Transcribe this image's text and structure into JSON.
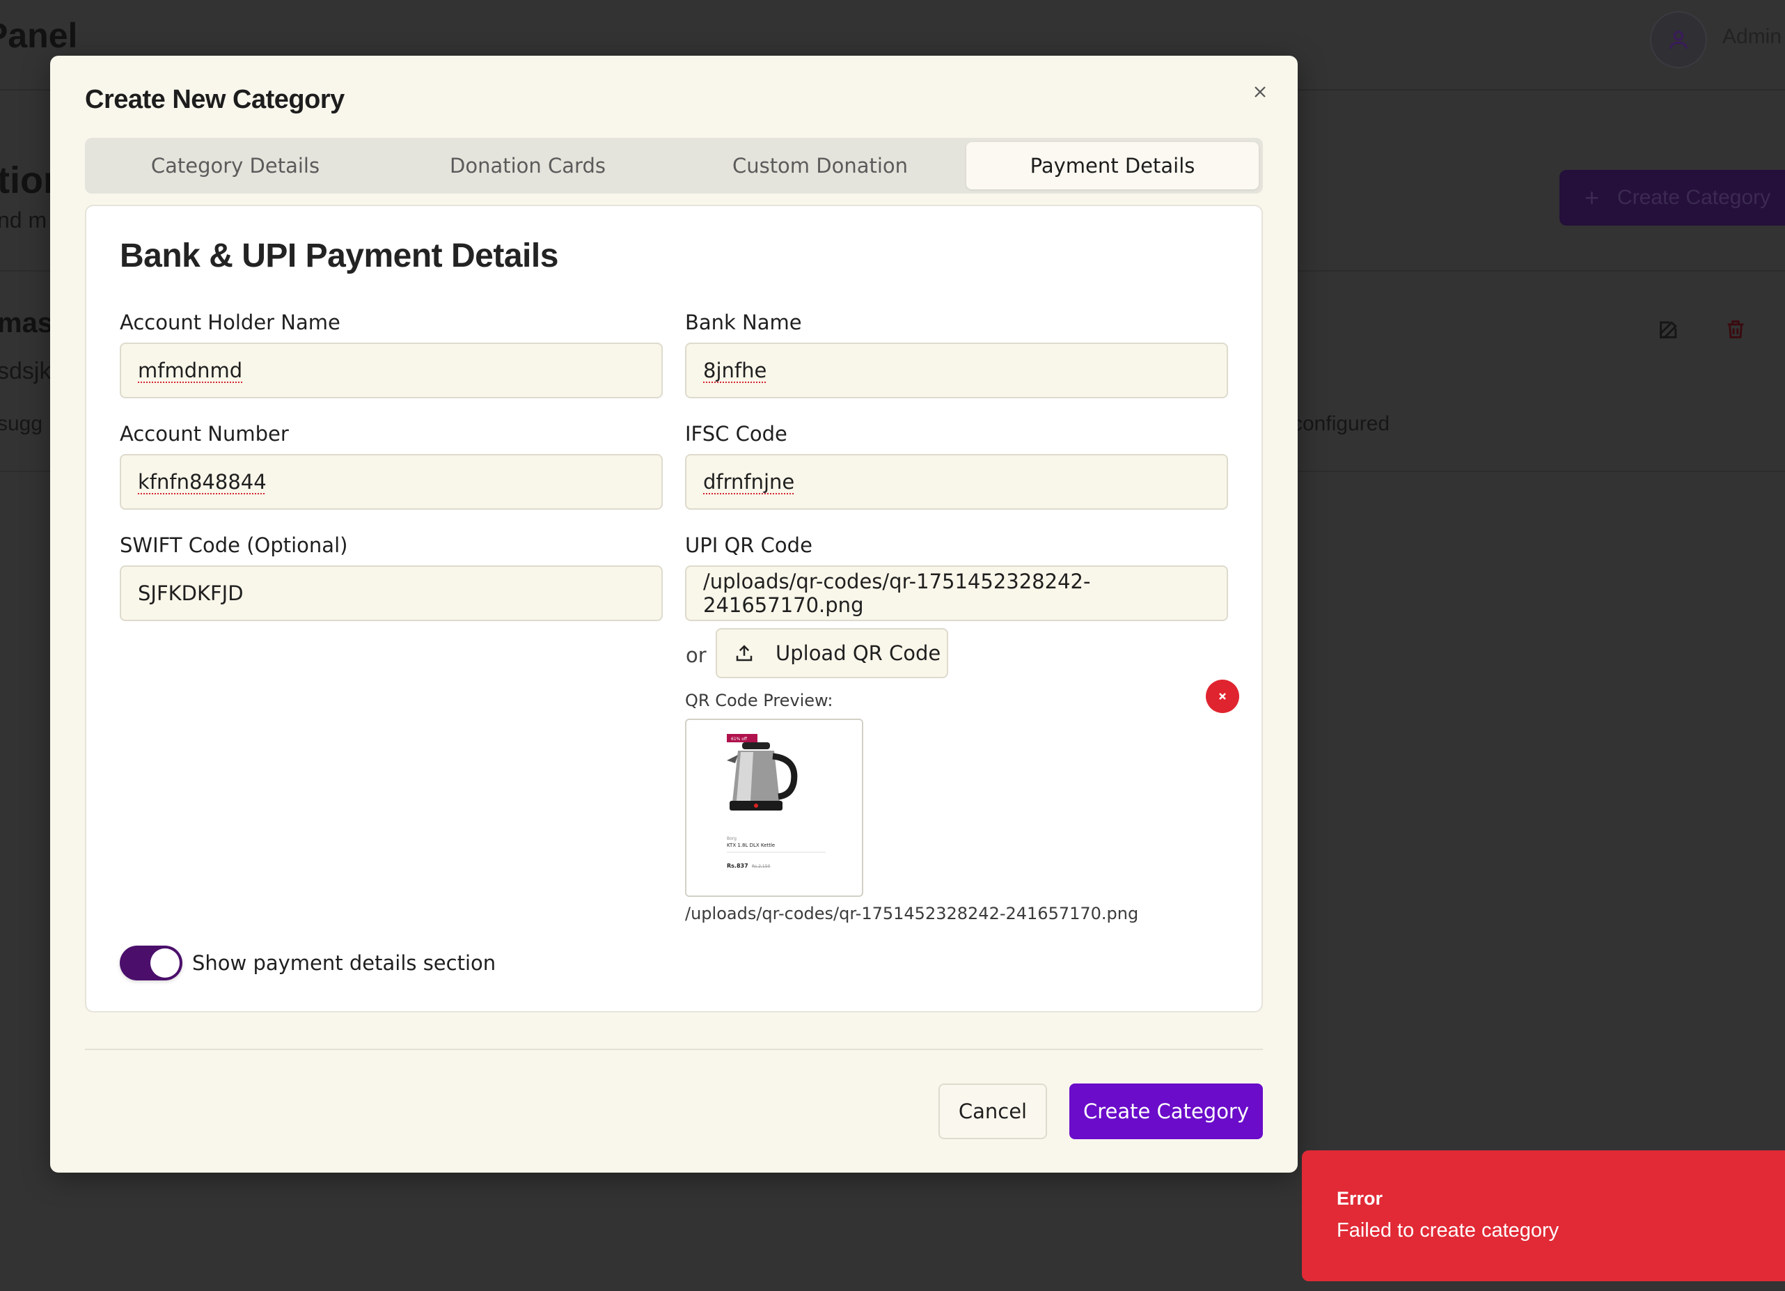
{
  "background": {
    "header_title": "Panel",
    "user_label": "Admin",
    "page_heading_fragment": "tion",
    "page_subtitle_fragment": "nd m",
    "create_button_label": "Create Category",
    "row": {
      "title_fragment": "mast",
      "description_fragment": "sdsjk",
      "suggestion_fragment": "sugg",
      "status_fragment": "configured"
    }
  },
  "modal": {
    "title": "Create New Category",
    "tabs": [
      {
        "label": "Category Details",
        "active": false
      },
      {
        "label": "Donation Cards",
        "active": false
      },
      {
        "label": "Custom Donation",
        "active": false
      },
      {
        "label": "Payment Details",
        "active": true
      }
    ],
    "section_title": "Bank & UPI Payment Details",
    "fields": {
      "account_holder": {
        "label": "Account Holder Name",
        "value": "mfmdnmd"
      },
      "bank_name": {
        "label": "Bank Name",
        "value": "8jnfhe"
      },
      "account_number": {
        "label": "Account Number",
        "value": "kfnfn848844"
      },
      "ifsc": {
        "label": "IFSC Code",
        "value": "dfrnfnjne"
      },
      "swift": {
        "label": "SWIFT Code (Optional)",
        "value": "SJFKDKFJD"
      },
      "upi_qr": {
        "label": "UPI QR Code",
        "value": "/uploads/qr-codes/qr-1751452328242-241657170.png"
      }
    },
    "or_text": "or",
    "upload_button_label": "Upload QR Code",
    "preview_label": "QR Code Preview:",
    "preview_path": "/uploads/qr-codes/qr-1751452328242-241657170.png",
    "preview_image": {
      "badge": "61% off",
      "brand": "Borg",
      "product": "KTX 1.8L DLX Kettle",
      "price": "Rs.837",
      "old_price": "Rs.2,150"
    },
    "toggle": {
      "label": "Show payment details section",
      "on": true
    },
    "cancel_label": "Cancel",
    "submit_label": "Create Category"
  },
  "toast": {
    "title": "Error",
    "message": "Failed to create category"
  },
  "colors": {
    "overlay": "#333333",
    "modal_bg": "#f9f7ec",
    "primary": "#6a0cc9",
    "toggle_on": "#4b0f6b",
    "error": "#e12a36"
  }
}
